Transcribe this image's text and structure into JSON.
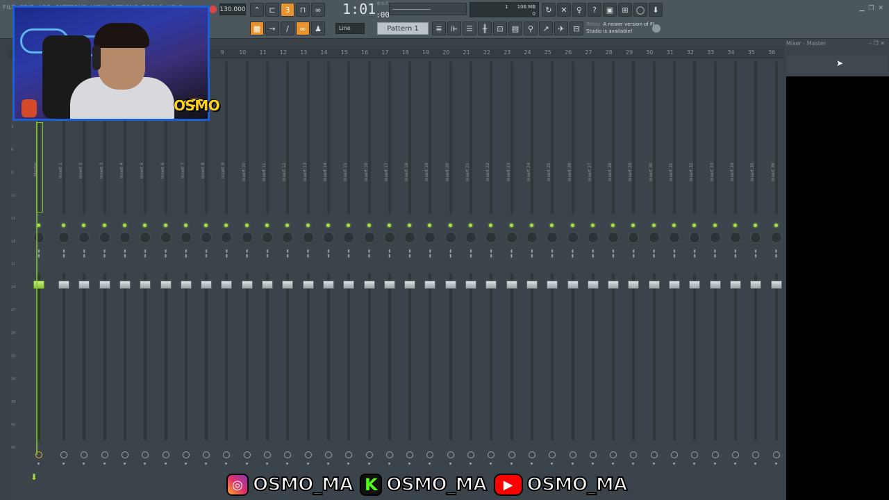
{
  "menu": [
    "FILE",
    "EDIT",
    "ADD",
    "PATTERNS",
    "VIEW",
    "OPTIONS",
    "TOOLS",
    "HELP"
  ],
  "toolbar": {
    "tempo": "130.000",
    "time_main": "1:01",
    "time_sub": ":00",
    "time_sup": "B:S:T",
    "memory": "106 MB",
    "cpu_line1": "1",
    "cpu_line2": "0",
    "snap": "Line",
    "pattern": "Pattern 1",
    "news_today": "Today",
    "news_text": "A newer version of FL Studio is available!"
  },
  "column_numbers": [
    "9",
    "10",
    "11",
    "12",
    "13",
    "14",
    "15",
    "16",
    "17",
    "18",
    "19",
    "20",
    "21",
    "22",
    "23",
    "24",
    "25",
    "26",
    "27",
    "28",
    "29",
    "30",
    "31",
    "32",
    "33",
    "34",
    "35",
    "36"
  ],
  "db_scale": [
    "3",
    "6",
    "9",
    "12",
    "15",
    "18",
    "21",
    "24",
    "27",
    "30",
    "33",
    "36",
    "39",
    "42",
    "45"
  ],
  "mixer": {
    "master_label": "Master",
    "inserts": [
      "Insert 1",
      "Insert 2",
      "Insert 3",
      "Insert 4",
      "Insert 5",
      "Insert 6",
      "Insert 7",
      "Insert 8",
      "Insert 9",
      "Insert 10",
      "Insert 11",
      "Insert 12",
      "Insert 13",
      "Insert 14",
      "Insert 15",
      "Insert 16",
      "Insert 17",
      "Insert 18",
      "Insert 19",
      "Insert 20",
      "Insert 21",
      "Insert 22",
      "Insert 23",
      "Insert 24",
      "Insert 25",
      "Insert 26",
      "Insert 27",
      "Insert 28",
      "Insert 29",
      "Insert 30",
      "Insert 31",
      "Insert 32",
      "Insert 33",
      "Insert 34",
      "Insert 35",
      "Insert 36"
    ]
  },
  "right_panel": {
    "title": "Mixer - Master"
  },
  "overlay": {
    "logo_text": "OSMO",
    "socials": [
      {
        "icon": "instagram-icon",
        "glyph": "◎",
        "handle": "OSMO_MA"
      },
      {
        "icon": "kick-icon",
        "glyph": "K",
        "handle": "OSMO_MA"
      },
      {
        "icon": "youtube-icon",
        "glyph": "▶",
        "handle": "OSMO_MA"
      }
    ]
  },
  "colors": {
    "accent_orange": "#e8922e",
    "led_green": "#a9e04a",
    "webcam_border": "#1b5fd6",
    "logo_yellow": "#ffcf1f"
  }
}
